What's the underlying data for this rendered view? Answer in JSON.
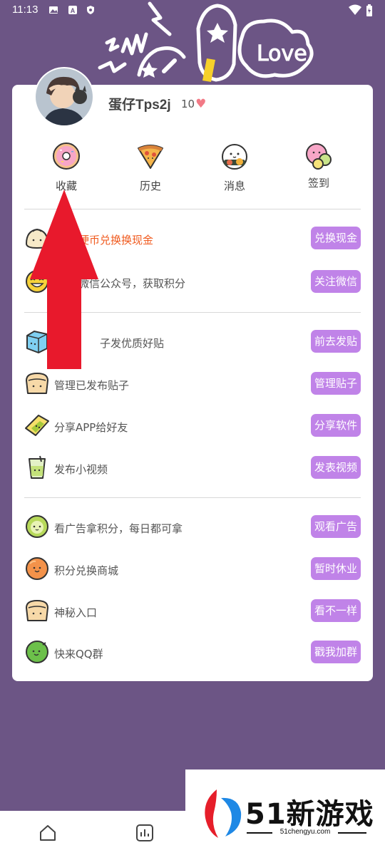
{
  "status_bar": {
    "time": "11:13"
  },
  "profile": {
    "username": "蛋仔Tps2j",
    "points": "10"
  },
  "quick_actions": [
    {
      "label": "收藏",
      "icon": "donut-icon"
    },
    {
      "label": "历史",
      "icon": "pizza-icon"
    },
    {
      "label": "消息",
      "icon": "sushi-icon"
    },
    {
      "label": "签到",
      "icon": "mochi-icon"
    }
  ],
  "group1": [
    {
      "text": "硬币兑换换现金",
      "button": "兑换现金",
      "icon": "bun-icon",
      "highlight": true
    },
    {
      "text": "微信公众号，获取积分",
      "button": "关注微信",
      "icon": "smile-icon"
    }
  ],
  "group2": [
    {
      "text": "子发优质好贴",
      "button": "前去发贴",
      "icon": "ice-cube-icon"
    },
    {
      "text": "管理已发布贴子",
      "button": "管理贴子",
      "icon": "bread-icon"
    },
    {
      "text": "分享APP给好友",
      "button": "分享软件",
      "icon": "cheese-icon"
    },
    {
      "text": "发布小视频",
      "button": "发表视频",
      "icon": "drink-icon"
    }
  ],
  "group3": [
    {
      "text": "看广告拿积分，每日都可拿",
      "button": "观看广告",
      "icon": "pea-icon"
    },
    {
      "text": "积分兑换商城",
      "button": "暂时休业",
      "icon": "orange-icon"
    },
    {
      "text": "神秘入口",
      "button": "看不一样",
      "icon": "bread-icon"
    },
    {
      "text": "快来QQ群",
      "button": "戳我加群",
      "icon": "lime-icon"
    }
  ],
  "watermark": {
    "brand": "51新游戏",
    "url": "51chengyu.com"
  },
  "colors": {
    "background": "#6c5585",
    "button": "#c083e8",
    "highlight_text": "#f05a1e",
    "arrow": "#e8192c"
  }
}
